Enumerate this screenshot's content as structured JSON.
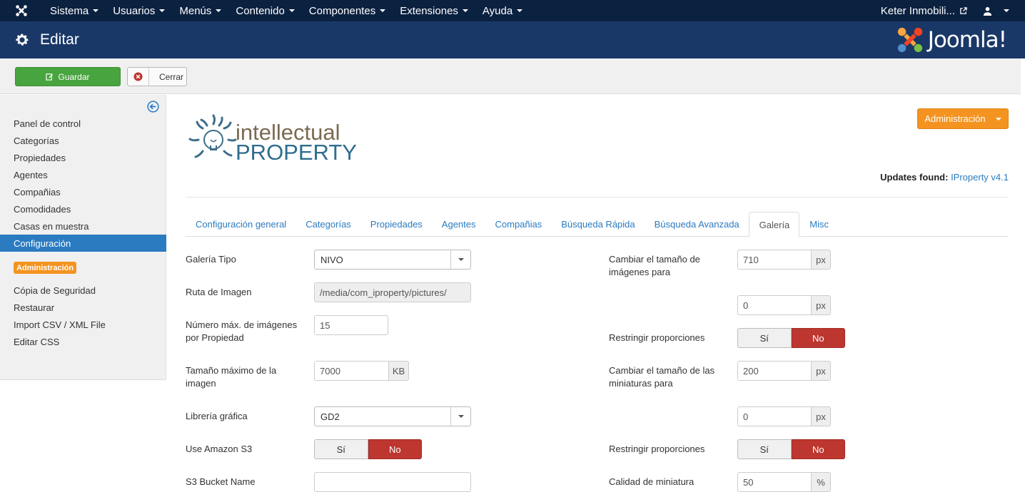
{
  "navbar": {
    "menu": [
      "Sistema",
      "Usuarios",
      "Menús",
      "Contenido",
      "Componentes",
      "Extensiones",
      "Ayuda"
    ],
    "site_name": "Keter Inmobili..."
  },
  "header": {
    "title": "Editar",
    "brand": "Joomla!"
  },
  "toolbar": {
    "save_label": "Guardar",
    "close_label": "Cerrar"
  },
  "sidebar": {
    "items": [
      "Panel de control",
      "Categorías",
      "Propiedades",
      "Agentes",
      "Compañias",
      "Comodidades",
      "Casas en muestra",
      "Configuración"
    ],
    "active": "Configuración",
    "badge": "Administración",
    "items2": [
      "Cópia de Seguridad",
      "Restaurar",
      "Import CSV / XML File",
      "Editar CSS"
    ]
  },
  "logo": {
    "line1": "intellectual",
    "line2": "PROPERTY"
  },
  "admin_button": "Administración",
  "updates": {
    "label": "Updates found:",
    "link": "IProperty v4.1"
  },
  "tabs": [
    "Configuración general",
    "Categorías",
    "Propiedades",
    "Agentes",
    "Compañias",
    "Búsqueda Rápida",
    "Búsqueda Avanzada",
    "Galería",
    "Misc"
  ],
  "active_tab": "Galería",
  "form_left": {
    "gallery_type_label": "Galería Tipo",
    "gallery_type_value": "NIVO",
    "image_path_label": "Ruta de Imagen",
    "image_path_value": "/media/com_iproperty/pictures/",
    "max_images_label": "Número máx. de imágenes por Propiedad",
    "max_images_value": "15",
    "max_size_label": "Tamaño máximo de la imagen",
    "max_size_value": "7000",
    "max_size_unit": "KB",
    "graphics_lib_label": "Librería gráfica",
    "graphics_lib_value": "GD2",
    "amazon_label": "Use Amazon S3",
    "bucket_label": "S3 Bucket Name",
    "bucket_value": ""
  },
  "form_right": {
    "resize_images_label": "Cambiar el tamaño de imágenes para",
    "resize_images_width": "710",
    "resize_images_height": "0",
    "unit_px": "px",
    "restrict_label": "Restringir proporciones",
    "resize_thumbs_label": "Cambiar el tamaño de las miniaturas para",
    "resize_thumbs_width": "200",
    "resize_thumbs_height": "0",
    "restrict2_label": "Restringir proporciones",
    "quality_label": "Calidad de miniatura",
    "quality_value": "50",
    "quality_unit": "%"
  },
  "toggle": {
    "yes": "Sí",
    "no": "No"
  }
}
